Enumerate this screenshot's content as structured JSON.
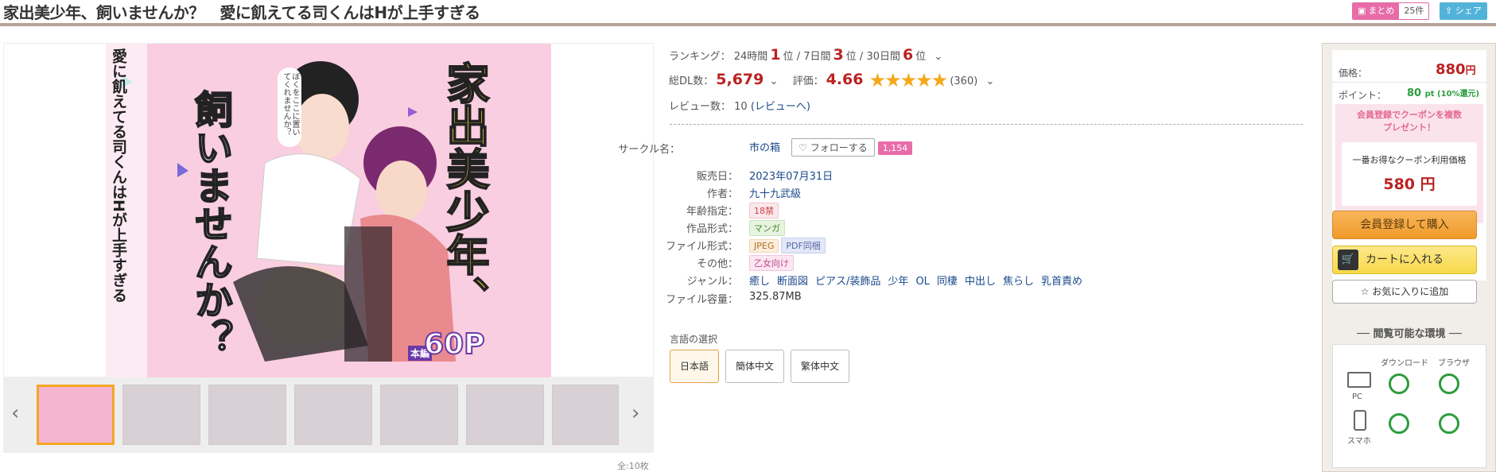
{
  "title": "家出美少年、飼いませんか？　愛に飢えてる司くんはHが上手すぎる",
  "badges": {
    "matome": "まとめ",
    "matome_count": "25件",
    "share": "シェア"
  },
  "gallery": {
    "count_text": "全:10枚",
    "prev": "‹",
    "next": "›"
  },
  "cover_text": {
    "title_right": "家出美少年、",
    "title_mid": "飼いませんか？",
    "subtitle": "愛に飢えてる司くんはHが上手すぎる",
    "speech": "ぼくをここに置いてくれませんか？",
    "pages_label": "本編",
    "pages": "60P"
  },
  "ranking": {
    "label": "ランキング：",
    "h24": "24時間",
    "h24_val": "1",
    "pos1": "位",
    "d7": "7日間",
    "d7_val": "3",
    "pos2": "位",
    "d30": "30日間",
    "d30_val": "6",
    "pos3": "位",
    "sep1": "/",
    "sep2": "/"
  },
  "stats": {
    "dl_label": "総DL数：",
    "dl_val": "5,679",
    "rating_label": "評価：",
    "rating_val": "4.66",
    "stars": "★★★★★",
    "rating_count": "(360)",
    "review_label": "レビュー数：",
    "review_val": "10",
    "review_link": "(レビューへ)"
  },
  "details": {
    "circle_label": "サークル名：",
    "circle": "市の箱",
    "follow": "フォローする",
    "follow_count": "1,154",
    "release_label": "販売日：",
    "release": "2023年07月31日",
    "author_label": "作者：",
    "author": "九十九武級",
    "age_label": "年齢指定：",
    "age": "18禁",
    "format_label": "作品形式：",
    "format": "マンガ",
    "file_label": "ファイル形式：",
    "file1": "JPEG",
    "file2": "PDF同梱",
    "other_label": "その他：",
    "other": "乙女向け",
    "genre_label": "ジャンル：",
    "genres": [
      "癒し",
      "断面図",
      "ピアス/装飾品",
      "少年",
      "OL",
      "同棲",
      "中出し",
      "焦らし",
      "乳首責め"
    ],
    "size_label": "ファイル容量：",
    "size": "325.87MB"
  },
  "language": {
    "label": "言語の選択",
    "options": [
      "日本語",
      "簡体中文",
      "繁体中文"
    ],
    "selected": "日本語"
  },
  "sidebar": {
    "price_label": "価格：",
    "price": "880",
    "yen": "円",
    "point_label": "ポイント：",
    "point": "80",
    "point_unit": "pt (10%還元)",
    "coupon_promo_1": "会員登録でクーポンを複数",
    "coupon_promo_2": "プレゼント！",
    "coupon_label": "一番お得なクーポン利用価格",
    "coupon_price": "580 円",
    "buy": "会員登録して購入",
    "cart": "カートに入れる",
    "fav": "お気に入りに追加",
    "env_title": "閲覧可能な環境",
    "env_download": "ダウンロード",
    "env_browser": "ブラウザ",
    "env_pc": "PC",
    "env_phone": "スマホ"
  },
  "colors": {
    "accent_red": "#b22222",
    "star": "#f4a91a",
    "pink": "#e86ca8",
    "buy_orange": "#f5a23a",
    "cart_yellow": "#fbe26a",
    "ok_green": "#2c9c3e"
  }
}
